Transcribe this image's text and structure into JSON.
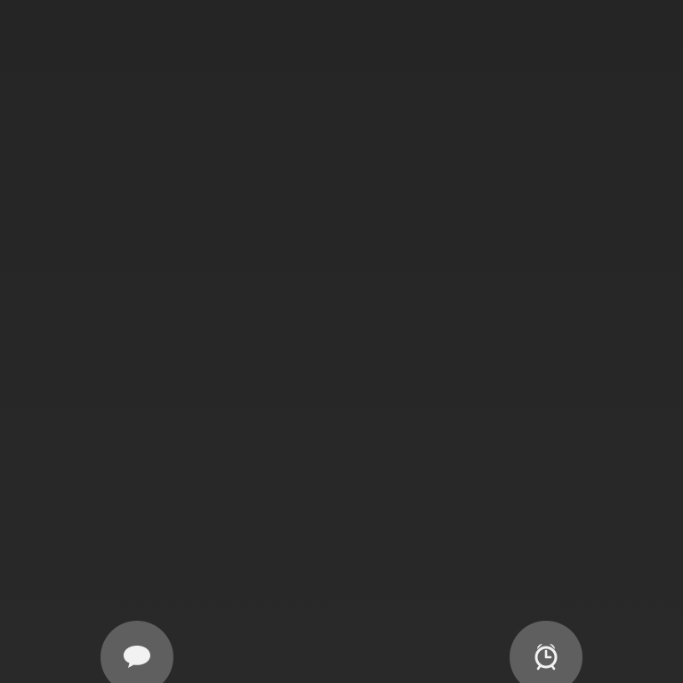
{
  "screen": {
    "background_color": "#272727"
  },
  "bottom_actions": {
    "left_button": {
      "icon": "speech-bubble-icon",
      "color": "#5f5f5f"
    },
    "right_button": {
      "icon": "alarm-clock-icon",
      "color": "#5f5f5f"
    }
  }
}
